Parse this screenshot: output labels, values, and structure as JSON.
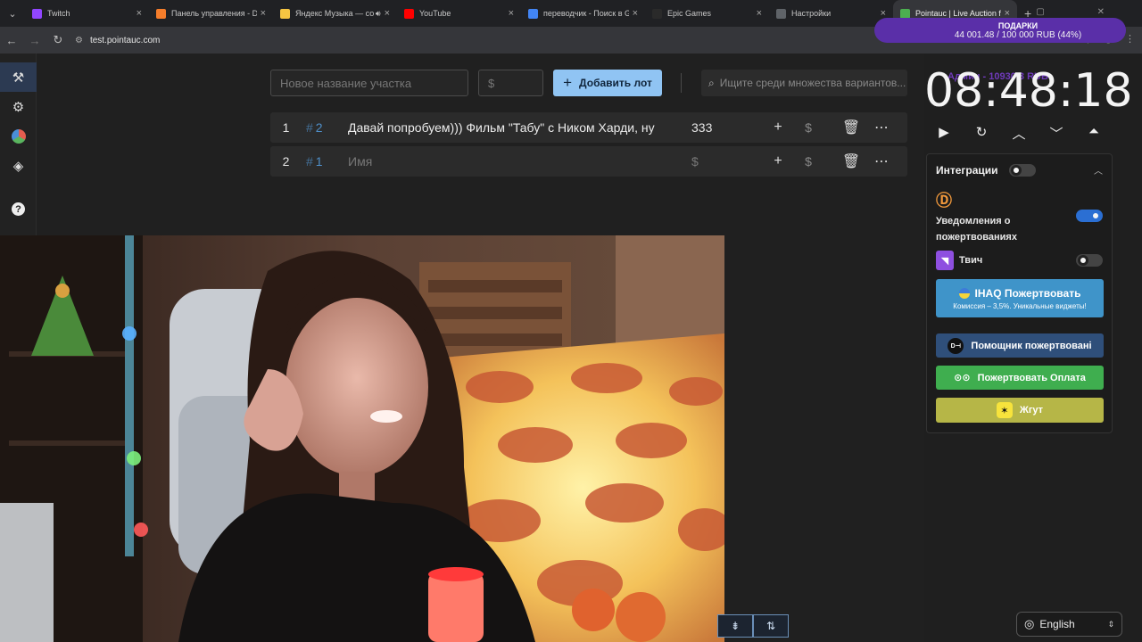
{
  "browser": {
    "tabs": [
      {
        "title": "Twitch",
        "icon": "twitch-icon",
        "color": "#9146ff"
      },
      {
        "title": "Панель управления - Do",
        "icon": "donationalerts-icon",
        "color": "#f57d2b"
      },
      {
        "title": "Яндекс Музыка — со",
        "icon": "yandex-music-icon",
        "color": "#f5c542"
      },
      {
        "title": "YouTube",
        "icon": "youtube-icon",
        "color": "#ff0000"
      },
      {
        "title": "переводчик - Поиск в G",
        "icon": "google-icon",
        "color": "#4285f4"
      },
      {
        "title": "Epic Games",
        "icon": "epic-games-icon",
        "color": "#2a2a2a"
      },
      {
        "title": "Настройки",
        "icon": "settings-icon",
        "color": "#5f6368"
      },
      {
        "title": "Pointauc | Live Auction fo",
        "icon": "pointauc-icon",
        "color": "#4caf50"
      }
    ],
    "url": "test.pointauc.com"
  },
  "overlay": {
    "label": "ПОДАРКИ",
    "progress": "44 001.48 / 100 000 RUB (44%)"
  },
  "toolbar": {
    "name_placeholder": "Новое название участка",
    "amount_placeholder": "$",
    "add_label": "Добавить лот",
    "search_placeholder": "Ищите среди множества вариантов..."
  },
  "lots": [
    {
      "num": "1",
      "id": "2",
      "name": "Давай попробуем))) Фильм \"Табу\" с Ником Харди, ну",
      "amount": "333",
      "name_placeholder": false,
      "amount_placeholder": false
    },
    {
      "num": "2",
      "id": "1",
      "name": "Имя",
      "amount": "$",
      "name_placeholder": true,
      "amount_placeholder": true
    }
  ],
  "timer": {
    "label": "Админ - 10930.3 RUB",
    "value": "08:48:18"
  },
  "integrations": {
    "title": "Интеграции",
    "enabled": false,
    "donation_notifications_label": "Уведомления о пожертвованиях",
    "donation_notifications_on": true,
    "twitch_label": "Твич",
    "twitch_on": false,
    "pay_ihaq_title": "IHAQ Пожертвовать",
    "pay_ihaq_subtitle": "Комиссия – 3,5%. Уникальные виджеты!",
    "pay_dh": "Помощник пожертвовані",
    "pay_opl": "Пожертвовать Оплата",
    "pay_zhgut": "Жгут"
  },
  "language": "English",
  "colors": {
    "accent": "#90c4f3",
    "lot_id": "#4f8fc9",
    "toggle_on": "#2b6fd3",
    "ihaq": "#3f94c9",
    "dh": "#2f4f7a",
    "opl": "#3fae4f",
    "zhgut": "#b6b647"
  }
}
